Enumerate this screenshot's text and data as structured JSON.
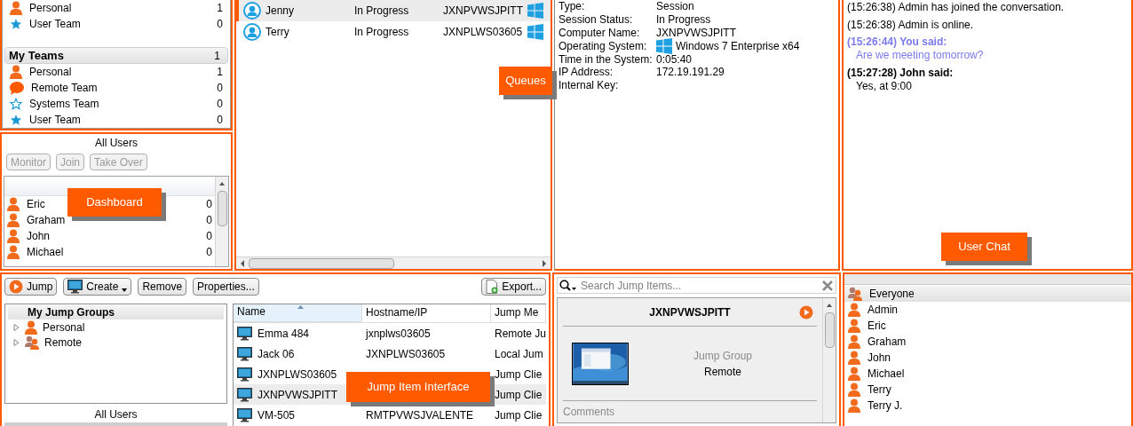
{
  "teams_top": [
    {
      "kind": "person",
      "name": "Personal",
      "count": "1"
    },
    {
      "kind": "star",
      "name": "User Team",
      "count": "0"
    }
  ],
  "my_teams": {
    "title": "My Teams",
    "count": "1",
    "items": [
      {
        "kind": "person",
        "name": "Personal",
        "count": "1"
      },
      {
        "kind": "chat",
        "name": "Remote Team",
        "count": "0"
      },
      {
        "kind": "star-outline",
        "name": "Systems Team",
        "count": "0"
      },
      {
        "kind": "star",
        "name": "User Team",
        "count": "0"
      }
    ]
  },
  "dashboard": {
    "title": "All Users",
    "callout": "Dashboard",
    "buttons": [
      {
        "label": "Monitor",
        "disabled": true
      },
      {
        "label": "Join",
        "disabled": true
      },
      {
        "label": "Take Over",
        "disabled": true
      }
    ],
    "users": [
      {
        "name": "Eric",
        "count": "0"
      },
      {
        "name": "Graham",
        "count": "0"
      },
      {
        "name": "John",
        "count": "0"
      },
      {
        "name": "Michael",
        "count": "0"
      }
    ]
  },
  "queue": {
    "callout": "Queues",
    "rows": [
      {
        "name": "Jenny",
        "status": "In Progress",
        "computer": "JXNPVWSJPITT",
        "selected": true
      },
      {
        "name": "Terry",
        "status": "In Progress",
        "computer": "JXNPLWS03605",
        "selected": false
      }
    ]
  },
  "session_details": [
    {
      "kind": "text",
      "label": "Type:",
      "value": "Session"
    },
    {
      "kind": "text",
      "label": "Session Status:",
      "value": "In Progress"
    },
    {
      "kind": "text",
      "label": "Computer Name:",
      "value": "JXNPVWSJPITT"
    },
    {
      "kind": "os",
      "label": "Operating System:",
      "value": "Windows 7 Enterprise x64"
    },
    {
      "kind": "text",
      "label": "Time in the System:",
      "value": "0:05:40"
    },
    {
      "kind": "text",
      "label": "IP Address:",
      "value": "172.19.191.29"
    },
    {
      "kind": "text",
      "label": "Internal Key:"
    }
  ],
  "chat": {
    "callout": "User Chat",
    "messages": [
      {
        "kind": "system",
        "text": "(15:26:38) Admin has joined the conversation."
      },
      {
        "kind": "system",
        "text": "(15:26:38) Admin is online."
      },
      {
        "kind": "self",
        "header": "(15:26:44) You said:",
        "text": "Are we meeting tomorrow?"
      },
      {
        "kind": "other",
        "header": "(15:27:28) John said:",
        "text": "Yes, at 9:00"
      }
    ]
  },
  "toolbar": [
    {
      "kind": "jump",
      "label": "Jump"
    },
    {
      "kind": "create",
      "label": "Create"
    },
    {
      "kind": "plain",
      "label": "Remove"
    },
    {
      "kind": "plain",
      "label": "Properties..."
    }
  ],
  "export_button": "Export...",
  "jump_groups": {
    "title": "My Jump Groups",
    "items": [
      {
        "kind": "person",
        "name": "Personal",
        "expanded": false
      },
      {
        "kind": "group",
        "name": "Remote",
        "expanded": false
      }
    ]
  },
  "all_users_label": "All Users",
  "jump_table": {
    "callout": "Jump Item Interface",
    "columns": [
      {
        "label": "Name",
        "sorted": true
      },
      {
        "label": "Hostname/IP",
        "sorted": false
      },
      {
        "label": "Jump Me",
        "sorted": false
      }
    ],
    "rows": [
      {
        "name": "Emma 484",
        "hostname": "jxnplws03605",
        "method": "Remote Ju",
        "selected": false
      },
      {
        "name": "Jack 06",
        "hostname": "JXNPLWS03605",
        "method": "Local Jum",
        "selected": false
      },
      {
        "name": "JXNPLWS03605",
        "method": "Jump Clie",
        "selected": false
      },
      {
        "name": "JXNPVWSJPITT",
        "method": "Jump Clie",
        "selected": true
      },
      {
        "name": "VM-505",
        "hostname": "RMTPVWSJVALENTE",
        "method": "Jump Clie",
        "selected": false
      }
    ]
  },
  "search": {
    "placeholder": "Search Jump Items..."
  },
  "jump_detail": {
    "title": "JXNPVWSJPITT",
    "group_label": "Jump Group",
    "group": "Remote",
    "comments_label": "Comments"
  },
  "chat_users": [
    {
      "kind": "group",
      "name": "Everyone",
      "selected": true
    },
    {
      "kind": "person",
      "name": "Admin",
      "selected": false
    },
    {
      "kind": "person",
      "name": "Eric",
      "selected": false
    },
    {
      "kind": "person",
      "name": "Graham",
      "selected": false
    },
    {
      "kind": "person",
      "name": "John",
      "selected": false
    },
    {
      "kind": "person",
      "name": "Michael",
      "selected": false
    },
    {
      "kind": "person",
      "name": "Terry",
      "selected": false
    },
    {
      "kind": "person",
      "name": "Terry J.",
      "selected": false
    }
  ]
}
